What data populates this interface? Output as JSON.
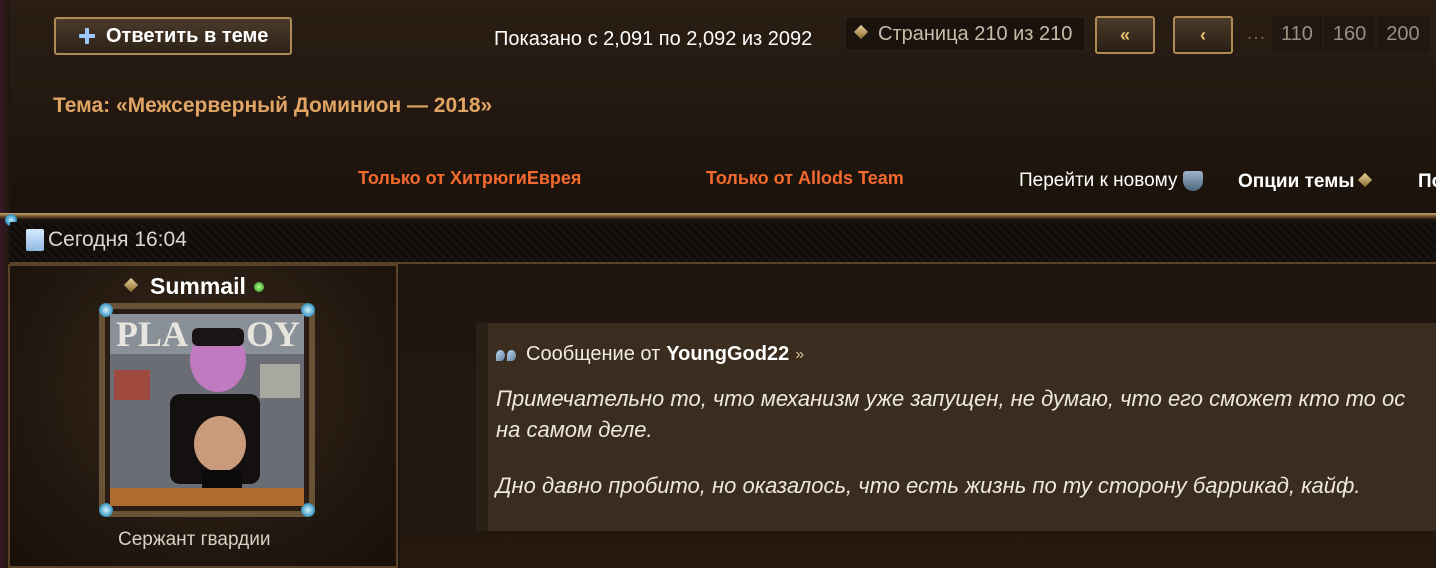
{
  "toolbar": {
    "reply_label": "Ответить в теме",
    "shown_text": "Показано с 2,091 по 2,092 из 2092",
    "page_info": "Страница 210 из 210",
    "first_icon": "«",
    "prev_icon": "‹",
    "pager_dots": "…",
    "pager_pages": [
      "110",
      "160",
      "200"
    ]
  },
  "thread": {
    "title": "Тема: «Межсерверный Доминион — 2018»",
    "only_from_1": "Только от ХитрюгиЕврея",
    "only_from_2": "Только от Allods Team",
    "goto_new": "Перейти к новому",
    "options": "Опции темы",
    "options_cut": "По"
  },
  "post": {
    "date": "Сегодня 16:04",
    "username": "Summail",
    "rank": "Сержант гвардии",
    "quote": {
      "prefix": "Сообщение от",
      "author": "YoungGod22",
      "line1": "Примечательно то, что механизм уже запущен, не думаю, что его сможет кто то ос",
      "line2": "на самом деле.",
      "line3": "Дно давно пробито, но оказалось, что есть жизнь по ту сторону баррикад, кайф."
    }
  },
  "icons": {
    "reply": "plus-icon",
    "page": "diamond-icon",
    "goto": "shield-icon",
    "date": "document-icon",
    "online": "online-dot",
    "quote": "quote-marks-icon",
    "view_post": "arrow-icon"
  },
  "colors": {
    "thread_title": "#e0a464",
    "only_links": "#f36a2e",
    "background": "#1c140e"
  }
}
